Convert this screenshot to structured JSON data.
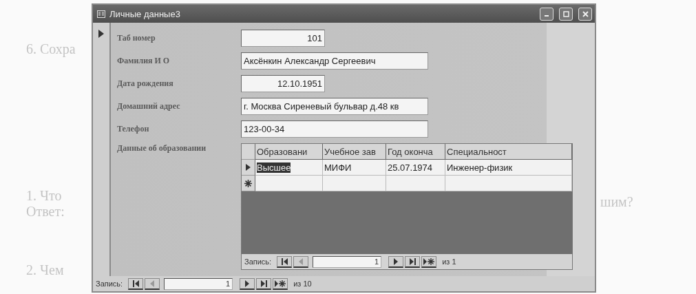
{
  "page_text_left": [
    "6. Сохра",
    "1. Что",
    "Ответ:",
    "2. Чем"
  ],
  "page_text_right": [
    "шим?"
  ],
  "window": {
    "title": "Личные данные3"
  },
  "fields": [
    {
      "label": "Таб номер",
      "value": "101",
      "kind": "number"
    },
    {
      "label": "Фамилия И О",
      "value": "Аксёнкин Александр Сергеевич",
      "kind": "text"
    },
    {
      "label": "Дата рождения",
      "value": "12.10.1951",
      "kind": "number"
    },
    {
      "label": "Домашний адрес",
      "value": "г. Москва Сиреневый бульвар д.48 кв",
      "kind": "text"
    },
    {
      "label": "Телефон",
      "value": "123-00-34",
      "kind": "text"
    }
  ],
  "subform": {
    "label": "Данные об образовании",
    "columns": [
      "Образовани",
      "Учебное зав",
      "Год оконча",
      "Специальност"
    ],
    "rows": [
      {
        "selected": true,
        "cells": [
          {
            "text": "Высшее",
            "selected": true
          },
          {
            "text": "МИФИ",
            "selected": false
          },
          {
            "text": "25.07.1974",
            "selected": false
          },
          {
            "text": "Инженер-физик",
            "selected": false
          }
        ]
      }
    ],
    "navigator": {
      "label": "Запись:",
      "current": "1",
      "total": "из 1"
    }
  },
  "navigator": {
    "label": "Запись:",
    "current": "1",
    "total": "из 10"
  }
}
